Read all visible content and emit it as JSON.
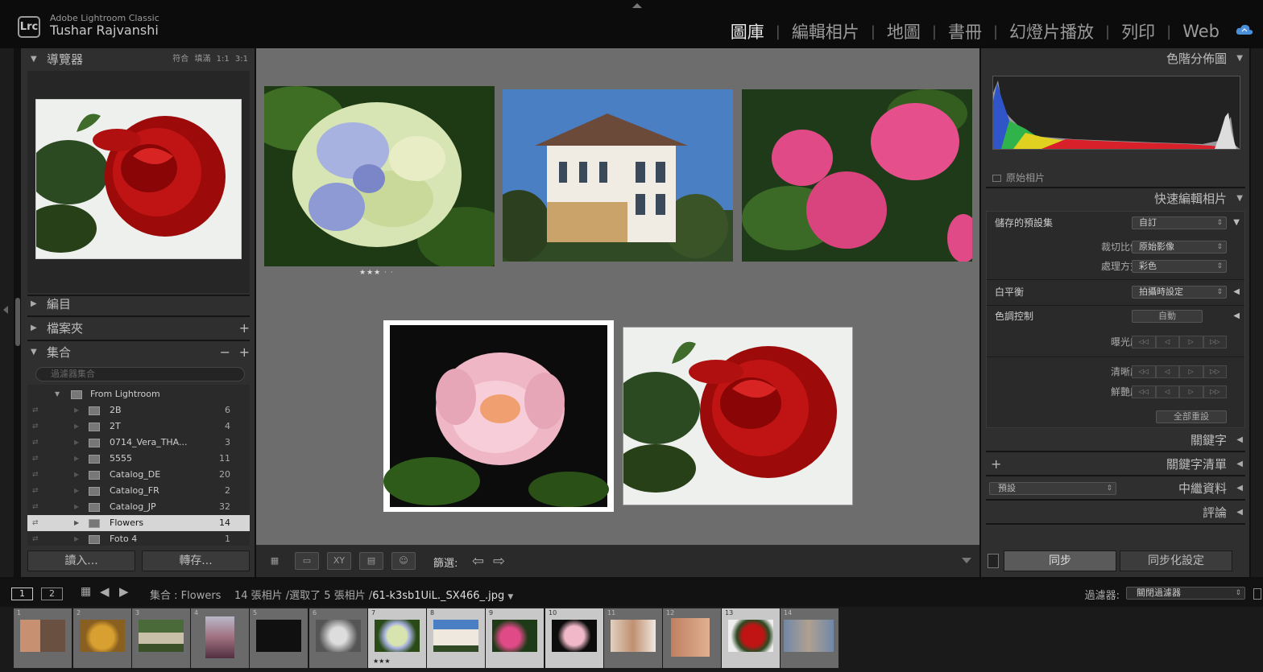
{
  "app": {
    "name": "Adobe Lightroom Classic",
    "logo": "Lrc",
    "user": "Tushar Rajvanshi"
  },
  "modules": [
    {
      "label": "圖庫",
      "active": true
    },
    {
      "label": "編輯相片",
      "active": false
    },
    {
      "label": "地圖",
      "active": false
    },
    {
      "label": "書冊",
      "active": false
    },
    {
      "label": "幻燈片播放",
      "active": false
    },
    {
      "label": "列印",
      "active": false
    },
    {
      "label": "Web",
      "active": false
    }
  ],
  "left": {
    "navigator": {
      "title": "導覽器",
      "zoom_options": "符合 填滿 1:1 3:1"
    },
    "catalog": {
      "title": "編目"
    },
    "folders": {
      "title": "檔案夾"
    },
    "collections": {
      "title": "集合",
      "search_placeholder": "過濾器集合"
    },
    "collection_set": "From Lightroom",
    "collection_items": [
      {
        "name": "2B",
        "count": "6"
      },
      {
        "name": "2T",
        "count": "4"
      },
      {
        "name": "0714_Vera_THA...",
        "count": "3"
      },
      {
        "name": "5555",
        "count": "11"
      },
      {
        "name": "Catalog_DE",
        "count": "20"
      },
      {
        "name": "Catalog_FR",
        "count": "2"
      },
      {
        "name": "Catalog_JP",
        "count": "32"
      },
      {
        "name": "Flowers",
        "count": "14"
      },
      {
        "name": "Foto 4",
        "count": "1"
      }
    ],
    "import_label": "讀入...",
    "export_label": "轉存..."
  },
  "grid": {
    "photos": [
      {
        "id": 1,
        "subject": "hydrangea-blue",
        "stars": "★★★ · ·"
      },
      {
        "id": 2,
        "subject": "house"
      },
      {
        "id": 3,
        "subject": "hydrangea-pink"
      },
      {
        "id": 4,
        "subject": "peony",
        "selected": true
      },
      {
        "id": 5,
        "subject": "rose"
      }
    ]
  },
  "toolbar": {
    "filter_label": "篩選:"
  },
  "right": {
    "histogram": {
      "title": "色階分佈圖",
      "original_photo_label": "原始相片"
    },
    "quick_develop": {
      "title": "快速編輯相片",
      "saved_preset_label": "儲存的預設集",
      "saved_preset_value": "自訂",
      "crop_label": "裁切比例",
      "crop_value": "原始影像",
      "treatment_label": "處理方式",
      "treatment_value": "彩色",
      "wb_label": "白平衡",
      "wb_value": "拍攝時設定",
      "tone_label": "色調控制",
      "tone_auto": "自動",
      "exposure_label": "曝光度",
      "clarity_label": "清晰度",
      "vibrance_label": "鮮艷度",
      "reset_all": "全部重設"
    },
    "keywording": {
      "title": "關鍵字"
    },
    "keyword_list": {
      "title": "關鍵字清單"
    },
    "metadata": {
      "title": "中繼資料",
      "preset": "預設"
    },
    "comments": {
      "title": "評論"
    },
    "sync_label": "同步",
    "sync_settings_label": "同步化設定"
  },
  "filmstrip": {
    "screen1": "1",
    "screen2": "2",
    "source": "集合 : Flowers",
    "counts": "14 張相片 /選取了 5 張相片 /",
    "filename": "61-k3sb1UiL._SX466_.jpg",
    "filter_label": "過濾器:",
    "filter_value": "關閉過濾器",
    "cells": [
      {
        "num": "1"
      },
      {
        "num": "2"
      },
      {
        "num": "3"
      },
      {
        "num": "4"
      },
      {
        "num": "5"
      },
      {
        "num": "6"
      },
      {
        "num": "7",
        "stars": "★★★"
      },
      {
        "num": "8"
      },
      {
        "num": "9"
      },
      {
        "num": "10"
      },
      {
        "num": "11"
      },
      {
        "num": "12"
      },
      {
        "num": "13"
      },
      {
        "num": "14"
      }
    ]
  }
}
